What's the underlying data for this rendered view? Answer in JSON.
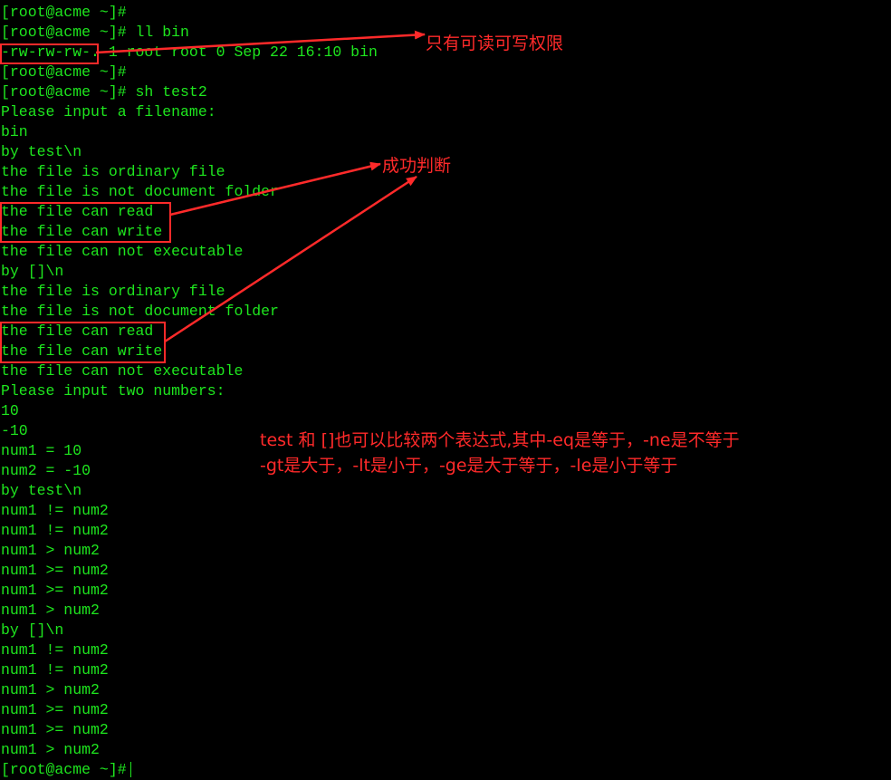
{
  "terminal": {
    "lines": [
      "[root@acme ~]#",
      "[root@acme ~]# ll bin",
      "-rw-rw-rw-. 1 root root 0 Sep 22 16:10 bin",
      "[root@acme ~]#",
      "[root@acme ~]# sh test2",
      "Please input a filename:",
      "bin",
      "by test\\n",
      "the file is ordinary file",
      "the file is not document folder",
      "the file can read",
      "the file can write",
      "the file can not executable",
      "by []\\n",
      "the file is ordinary file",
      "the file is not document folder",
      "the file can read",
      "the file can write",
      "the file can not executable",
      "Please input two numbers:",
      "10",
      "-10",
      "num1 = 10",
      "num2 = -10",
      "by test\\n",
      "num1 != num2",
      "num1 != num2",
      "num1 > num2",
      "num1 >= num2",
      "num1 >= num2",
      "num1 > num2",
      "by []\\n",
      "num1 != num2",
      "num1 != num2",
      "num1 > num2",
      "num1 >= num2",
      "num1 >= num2",
      "num1 > num2",
      "[root@acme ~]#"
    ]
  },
  "annotations": {
    "permission_note": "只有可读可写权限",
    "success_note": "成功判断",
    "compare_note_line1": "test 和 []也可以比较两个表达式,其中-eq是等于，-ne是不等于",
    "compare_note_line2": "-gt是大于，-lt是小于，-ge是大于等于，-le是小于等于"
  },
  "colors": {
    "terminal_text": "#1ee61e",
    "background": "#000000",
    "annotation": "#ff2a2a"
  }
}
